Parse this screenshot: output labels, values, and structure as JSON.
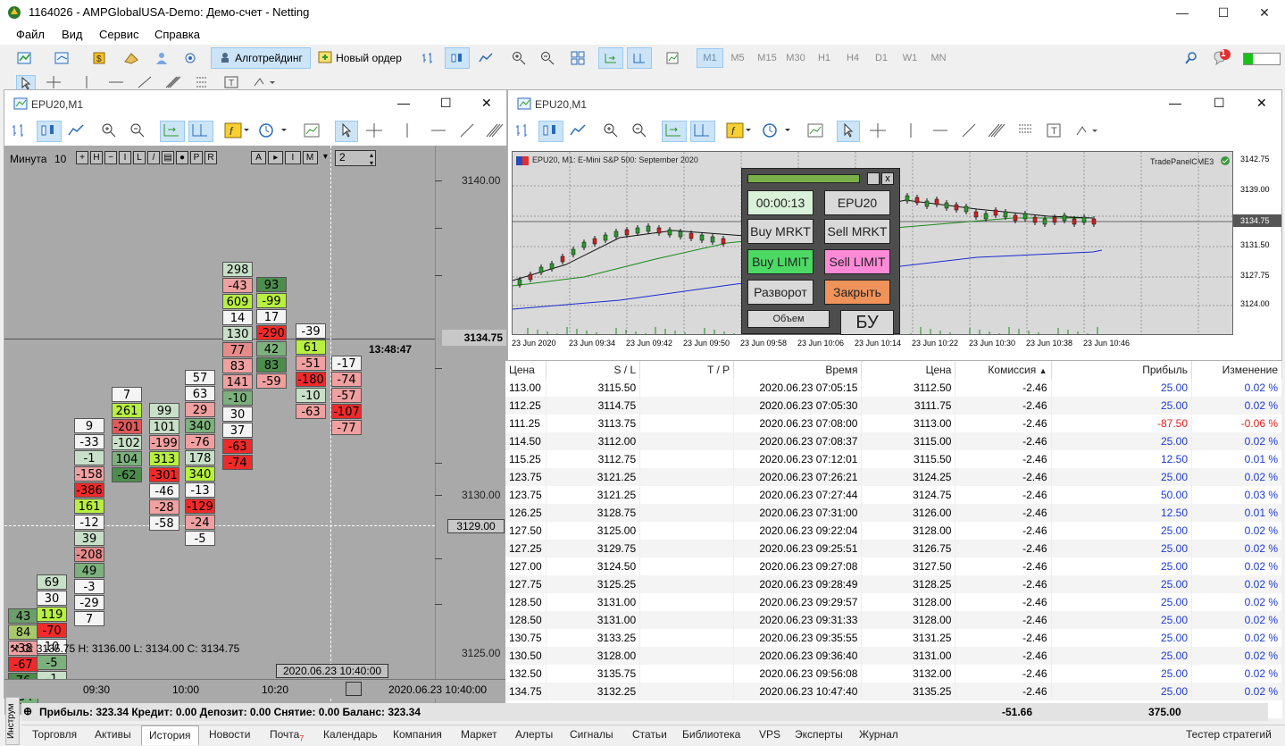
{
  "window": {
    "title": "1164026 - AMPGlobalUSA-Demo: Демо-счет - Netting"
  },
  "menu": [
    "Файл",
    "Вид",
    "Сервис",
    "Справка"
  ],
  "toolbar": {
    "algo_label": "Алготрейдинг",
    "new_order_label": "Новый ордер",
    "timeframes": [
      "M1",
      "M5",
      "M15",
      "M30",
      "H1",
      "H4",
      "D1",
      "W1",
      "MN"
    ],
    "notification_count": "1"
  },
  "left_chart": {
    "title": "EPU20,M1",
    "period_label": "Минута",
    "period_value": "10",
    "chart_buttons": [
      "H",
      "I",
      "L",
      "P",
      "R"
    ],
    "spinner_value": "2",
    "price_labels": [
      "3140.00",
      "3130.00",
      "3125.00"
    ],
    "current_price": "3134.75",
    "cross_price": "3129.00",
    "timer": "13:48:47",
    "ohlc": "O: 3135.75  H: 3136.00  L: 3134.00  C: 3134.75",
    "date_label": "2020.06.23 10:40:00",
    "time_axis": [
      "09:30",
      "10:00",
      "10:20"
    ],
    "time_axis_right": "2020.06.23 10:40:00",
    "columns": [
      {
        "cells": [
          [
            "43",
            "#6a9e6a"
          ],
          [
            "84",
            "#a8c96a"
          ],
          [
            "-38",
            "#f0a0a0"
          ],
          [
            "-67",
            "#f02a2a"
          ],
          [
            "76",
            "#4c8c4c"
          ],
          [
            "-34",
            "#7cb07c"
          ]
        ]
      },
      {
        "cells": [
          [
            "69",
            "#c8e0c8"
          ],
          [
            "30",
            "#f4f4f4"
          ],
          [
            "119",
            "#b8f040"
          ],
          [
            "-70",
            "#f02a2a"
          ],
          [
            "10",
            "#f4f4f4"
          ],
          [
            "-5",
            "#7cb07c"
          ],
          [
            "-1",
            "#c8e0c8"
          ]
        ]
      },
      {
        "cells": [
          [
            "9",
            "#f4f4f4"
          ],
          [
            "-33",
            "#f4f4f4"
          ],
          [
            "-1",
            "#c8e0c8"
          ],
          [
            "-158",
            "#f0a0a0"
          ],
          [
            "-386",
            "#f02a2a"
          ],
          [
            "161",
            "#b8f040"
          ],
          [
            "-12",
            "#f4f4f4"
          ],
          [
            "39",
            "#c8e0c8"
          ],
          [
            "-208",
            "#e68a8a"
          ],
          [
            "49",
            "#7cb07c"
          ],
          [
            "-3",
            "#f4f4f4"
          ],
          [
            "-29",
            "#f4f4f4"
          ],
          [
            "7",
            "#f4f4f4"
          ]
        ]
      },
      {
        "cells": [
          [
            "7",
            "#f4f4f4"
          ],
          [
            "261",
            "#b8f040"
          ],
          [
            "-201",
            "#e05a5a"
          ],
          [
            "-102",
            "#c8e0c8"
          ],
          [
            "104",
            "#7cb07c"
          ],
          [
            "-62",
            "#4c8c4c"
          ]
        ]
      },
      {
        "cells": [
          [
            "99",
            "#c8e0c8"
          ],
          [
            "101",
            "#c8e0c8"
          ],
          [
            "-199",
            "#f0a0a0"
          ],
          [
            "313",
            "#b8f040"
          ],
          [
            "-301",
            "#f02a2a"
          ],
          [
            "-46",
            "#f4f4f4"
          ],
          [
            "-28",
            "#f0a0a0"
          ],
          [
            "-58",
            "#f4f4f4"
          ]
        ]
      },
      {
        "cells": [
          [
            "57",
            "#f4f4f4"
          ],
          [
            "63",
            "#f4f4f4"
          ],
          [
            "29",
            "#f0a0a0"
          ],
          [
            "340",
            "#7cb07c"
          ],
          [
            "-76",
            "#f0a0a0"
          ],
          [
            "178",
            "#c8e0c8"
          ],
          [
            "340",
            "#b8f040"
          ],
          [
            "-13",
            "#f4f4f4"
          ],
          [
            "-129",
            "#f02a2a"
          ],
          [
            "-24",
            "#f0a0a0"
          ],
          [
            "-5",
            "#f4f4f4"
          ]
        ]
      },
      {
        "cells": [
          [
            "298",
            "#c8e0c8"
          ],
          [
            "-43",
            "#f0a0a0"
          ],
          [
            "609",
            "#b8f040"
          ],
          [
            "14",
            "#f4f4f4"
          ],
          [
            "130",
            "#c8e0c8"
          ],
          [
            "77",
            "#e68a8a"
          ],
          [
            "83",
            "#f0a0a0"
          ],
          [
            "141",
            "#f0a0a0"
          ],
          [
            "-10",
            "#7cb07c"
          ],
          [
            "30",
            "#f4f4f4"
          ],
          [
            "37",
            "#f4f4f4"
          ],
          [
            "-63",
            "#f02a2a"
          ],
          [
            "-74",
            "#f02a2a"
          ]
        ]
      },
      {
        "cells": [
          [
            "93",
            "#4c8c4c"
          ],
          [
            "-99",
            "#b8f040"
          ],
          [
            "17",
            "#f4f4f4"
          ],
          [
            "-290",
            "#f02a2a"
          ],
          [
            "42",
            "#7cb07c"
          ],
          [
            "83",
            "#4c8c4c"
          ],
          [
            "-59",
            "#f0a0a0"
          ]
        ]
      },
      {
        "cells": [
          [
            "-39",
            "#f4f4f4"
          ],
          [
            "61",
            "#b8f040"
          ],
          [
            "-51",
            "#f0a0a0"
          ],
          [
            "-180",
            "#f02a2a"
          ],
          [
            "-10",
            "#c8e0c8"
          ],
          [
            "-63",
            "#f0a0a0"
          ]
        ]
      },
      {
        "cells": [
          [
            "-17",
            "#f4f4f4"
          ],
          [
            "-74",
            "#f0a0a0"
          ],
          [
            "-57",
            "#f0a0a0"
          ],
          [
            "-107",
            "#f02a2a"
          ],
          [
            "-77",
            "#f0a0a0"
          ]
        ]
      }
    ]
  },
  "right_chart": {
    "title": "EPU20,M1",
    "header": "EPU20, M1: E-Mini S&P 500: September 2020",
    "panel_name": "TradePanelCME3",
    "price_axis": [
      "3142.75",
      "3139.00",
      "3134.75",
      "3131.50",
      "3127.75",
      "3124.00"
    ],
    "time_axis": [
      "23 Jun 2020",
      "23 Jun 09:34",
      "23 Jun 09:42",
      "23 Jun 09:50",
      "23 Jun 09:58",
      "23 Jun 10:06",
      "23 Jun 10:14",
      "23 Jun 10:22",
      "23 Jun 10:30",
      "23 Jun 10:38",
      "23 Jun 10:46"
    ]
  },
  "trade_panel": {
    "timer": "00:00:13",
    "symbol": "EPU20",
    "buy_market": "Buy MRKT",
    "sell_market": "Sell MRKT",
    "buy_limit": "Buy LIMIT",
    "sell_limit": "Sell LIMIT",
    "reverse": "Разворот",
    "close": "Закрыть",
    "volume": "Объем",
    "breakeven": "БУ"
  },
  "history": {
    "headers": [
      "Цена",
      "S / L",
      "T / P",
      "Время",
      "Цена",
      "Комиссия",
      "Прибыль",
      "Изменение"
    ],
    "rows": [
      [
        "113.00",
        "3115.50",
        "",
        "2020.06.23 07:05:15",
        "3112.50",
        "-2.46",
        "25.00",
        "0.02 %"
      ],
      [
        "112.25",
        "3114.75",
        "",
        "2020.06.23 07:05:30",
        "3111.75",
        "-2.46",
        "25.00",
        "0.02 %"
      ],
      [
        "111.25",
        "3113.75",
        "",
        "2020.06.23 07:08:00",
        "3113.00",
        "-2.46",
        "-87.50",
        "-0.06 %"
      ],
      [
        "114.50",
        "3112.00",
        "",
        "2020.06.23 07:08:37",
        "3115.00",
        "-2.46",
        "25.00",
        "0.02 %"
      ],
      [
        "115.25",
        "3112.75",
        "",
        "2020.06.23 07:12:01",
        "3115.50",
        "-2.46",
        "12.50",
        "0.01 %"
      ],
      [
        "123.75",
        "3121.25",
        "",
        "2020.06.23 07:26:21",
        "3124.25",
        "-2.46",
        "25.00",
        "0.02 %"
      ],
      [
        "123.75",
        "3121.25",
        "",
        "2020.06.23 07:27:44",
        "3124.75",
        "-2.46",
        "50.00",
        "0.03 %"
      ],
      [
        "126.25",
        "3128.75",
        "",
        "2020.06.23 07:31:00",
        "3126.00",
        "-2.46",
        "12.50",
        "0.01 %"
      ],
      [
        "127.50",
        "3125.00",
        "",
        "2020.06.23 09:22:04",
        "3128.00",
        "-2.46",
        "25.00",
        "0.02 %"
      ],
      [
        "127.25",
        "3129.75",
        "",
        "2020.06.23 09:25:51",
        "3126.75",
        "-2.46",
        "25.00",
        "0.02 %"
      ],
      [
        "127.00",
        "3124.50",
        "",
        "2020.06.23 09:27:08",
        "3127.50",
        "-2.46",
        "25.00",
        "0.02 %"
      ],
      [
        "127.75",
        "3125.25",
        "",
        "2020.06.23 09:28:49",
        "3128.25",
        "-2.46",
        "25.00",
        "0.02 %"
      ],
      [
        "128.50",
        "3131.00",
        "",
        "2020.06.23 09:29:57",
        "3128.00",
        "-2.46",
        "25.00",
        "0.02 %"
      ],
      [
        "128.50",
        "3131.00",
        "",
        "2020.06.23 09:31:33",
        "3128.00",
        "-2.46",
        "25.00",
        "0.02 %"
      ],
      [
        "130.75",
        "3133.25",
        "",
        "2020.06.23 09:35:55",
        "3131.25",
        "-2.46",
        "25.00",
        "0.02 %"
      ],
      [
        "130.50",
        "3128.00",
        "",
        "2020.06.23 09:36:40",
        "3131.00",
        "-2.46",
        "25.00",
        "0.02 %"
      ],
      [
        "132.50",
        "3135.75",
        "",
        "2020.06.23 09:56:08",
        "3132.00",
        "-2.46",
        "25.00",
        "0.02 %"
      ],
      [
        "134.75",
        "3132.25",
        "",
        "2020.06.23 10:47:40",
        "3135.25",
        "-2.46",
        "25.00",
        "0.02 %"
      ]
    ],
    "summary_text": "Прибыль: 323.34  Кредит: 0.00  Депозит: 0.00  Снятие: 0.00  Баланс: 323.34",
    "total_commission": "-51.66",
    "total_profit": "375.00"
  },
  "bottom_tabs": [
    "Торговля",
    "Активы",
    "История",
    "Новости",
    "Почта",
    "Календарь",
    "Компания",
    "Маркет",
    "Алерты",
    "Сигналы",
    "Статьи",
    "Библиотека",
    "VPS",
    "Эксперты",
    "Журнал"
  ],
  "mail_badge": "7",
  "side_tab": "Инструм",
  "strategy_tester": "Тестер стратегий",
  "colors": {
    "profit_positive": "#1d3ad1",
    "profit_negative": "#e31c1c",
    "buy_limit": "#4cd964",
    "sell_limit": "#ff8ad8",
    "close": "#f0935a"
  }
}
